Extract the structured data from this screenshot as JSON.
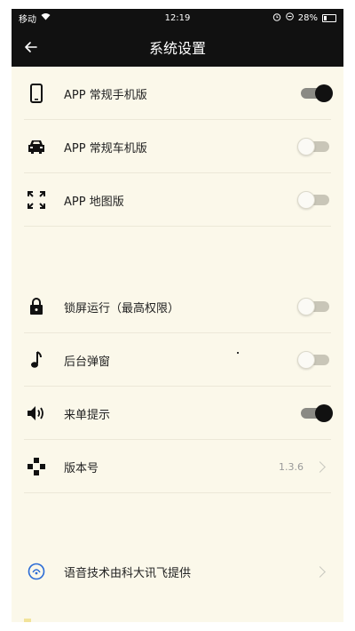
{
  "statusbar": {
    "carrier": "移动",
    "time": "12:19",
    "battery": "28%"
  },
  "navbar": {
    "title": "系统设置",
    "back_icon": "arrow-left-icon"
  },
  "group1": [
    {
      "icon": "phone-icon",
      "label": "APP 常规手机版",
      "toggle": "on"
    },
    {
      "icon": "car-icon",
      "label": "APP 常规车机版",
      "toggle": "off"
    },
    {
      "icon": "fullscreen-icon",
      "label": "APP 地图版",
      "toggle": "off"
    }
  ],
  "group2": [
    {
      "icon": "lock-icon",
      "label": "锁屏运行（最高权限）",
      "toggle": "off"
    },
    {
      "icon": "music-note-icon",
      "label": "后台弹窗",
      "toggle": "off"
    },
    {
      "icon": "speaker-icon",
      "label": "来单提示",
      "toggle": "on"
    },
    {
      "icon": "gamepad-icon",
      "label": "版本号",
      "value": "1.3.6"
    }
  ],
  "group3": [
    {
      "icon": "ifly-icon",
      "label": "语音技术由科大讯飞提供"
    }
  ],
  "colors": {
    "bar_bg": "#111111",
    "page_bg": "#fbf8ea",
    "toggle_on_knob": "#111111"
  }
}
